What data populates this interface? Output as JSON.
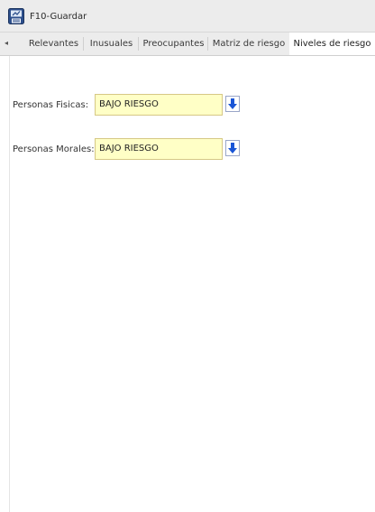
{
  "toolbar": {
    "save_label": "F10-Guardar",
    "save_icon": "save-icon"
  },
  "tabs": {
    "scroll_left_icon": "◂",
    "items": [
      {
        "label": "Relevantes"
      },
      {
        "label": "Inusuales"
      },
      {
        "label": "Preocupantes"
      },
      {
        "label": "Matriz de riesgo"
      },
      {
        "label": "Niveles de riesgo"
      }
    ],
    "active": "Niveles de riesgo"
  },
  "form": {
    "personas_fisicas": {
      "label": "Personas Fisicas:",
      "value": "BAJO RIESGO"
    },
    "personas_morales": {
      "label": "Personas Morales:",
      "value": "BAJO RIESGO"
    }
  },
  "colors": {
    "field_background": "#ffffc6",
    "dropdown_arrow": "#1a55d6"
  }
}
